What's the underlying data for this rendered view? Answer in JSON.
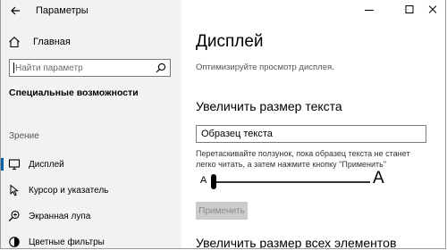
{
  "window": {
    "title": "Параметры"
  },
  "sidebar": {
    "home_label": "Главная",
    "search_placeholder": "Найти параметр",
    "section_title": "Специальные возможности",
    "group_title": "Зрение",
    "items": [
      {
        "label": "Дисплей",
        "icon": "display-icon",
        "active": true
      },
      {
        "label": "Курсор и указатель",
        "icon": "cursor-icon",
        "active": false
      },
      {
        "label": "Экранная лупа",
        "icon": "magnifier-icon",
        "active": false
      },
      {
        "label": "Цветные фильтры",
        "icon": "color-filter-icon",
        "active": false
      }
    ]
  },
  "main": {
    "title": "Дисплей",
    "subtitle": "Оптимизируйте просмотр дисплея.",
    "text_size": {
      "heading": "Увеличить размер текста",
      "sample_value": "Образец текста",
      "hint": "Перетаскивайте ползунок, пока образец текста не станет легко читать, а затем нажмите кнопку \"Применить\"",
      "slider_min_label": "A",
      "slider_max_label": "A",
      "slider_value_fraction": 0.0,
      "apply_label": "Применить"
    },
    "all_size_heading": "Увеличить размер всех элементов"
  },
  "colors": {
    "accent": "#0063b1",
    "sidebar_bg": "#f2f2f2",
    "disabled_button": "#cccccc"
  }
}
